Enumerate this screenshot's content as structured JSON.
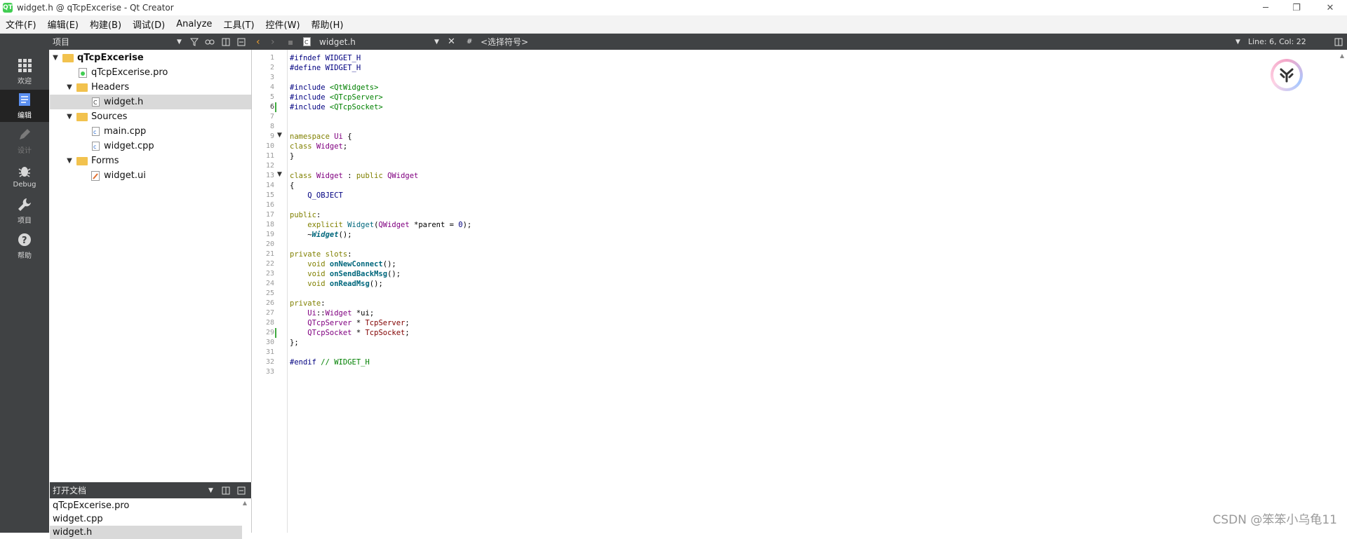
{
  "window": {
    "title": "widget.h @ qTcpExcerise - Qt Creator",
    "app_icon": "QT"
  },
  "menu": [
    "文件(F)",
    "编辑(E)",
    "构建(B)",
    "调试(D)",
    "Analyze",
    "工具(T)",
    "控件(W)",
    "帮助(H)"
  ],
  "toolbar": {
    "panel_title": "项目",
    "file_name": "widget.h",
    "symbol": "<选择符号>",
    "position": "Line: 6, Col: 22",
    "hash": "#"
  },
  "modes": [
    {
      "label": "欢迎",
      "icon": "grid-icon"
    },
    {
      "label": "编辑",
      "icon": "edit-doc-icon"
    },
    {
      "label": "设计",
      "icon": "pencil-icon"
    },
    {
      "label": "Debug",
      "icon": "bug-icon"
    },
    {
      "label": "项目",
      "icon": "wrench-icon"
    },
    {
      "label": "帮助",
      "icon": "help-icon"
    }
  ],
  "tree": {
    "project": "qTcpExcerise",
    "pro_file": "qTcpExcerise.pro",
    "headers": "Headers",
    "header_file": "widget.h",
    "sources": "Sources",
    "source_files": [
      "main.cpp",
      "widget.cpp"
    ],
    "forms": "Forms",
    "form_file": "widget.ui"
  },
  "open_docs": {
    "title": "打开文档",
    "items": [
      "qTcpExcerise.pro",
      "widget.cpp",
      "widget.h"
    ]
  },
  "line_numbers": [
    "1",
    "2",
    "3",
    "4",
    "5",
    "6",
    "7",
    "8",
    "9",
    "10",
    "11",
    "12",
    "13",
    "14",
    "15",
    "16",
    "17",
    "18",
    "19",
    "20",
    "21",
    "22",
    "23",
    "24",
    "25",
    "26",
    "27",
    "28",
    "29",
    "30",
    "31",
    "32",
    "33"
  ],
  "code": {
    "l1a": "#ifndef",
    "l1b": " WIDGET_H",
    "l2a": "#define",
    "l2b": " WIDGET_H",
    "l4a": "#include",
    "l4b": " <QtWidgets>",
    "l5a": "#include",
    "l5b": " <QTcpServer>",
    "l6a": "#include",
    "l6b": " <QTcpSocket>",
    "l9a": "namespace",
    "l9b": " Ui",
    "l9c": " {",
    "l10a": "class",
    "l10b": " Widget",
    "l10c": ";",
    "l11": "}",
    "l13a": "class",
    "l13b": " Widget",
    "l13c": " : ",
    "l13d": "public",
    "l13e": " QWidget",
    "l14": "{",
    "l15": "    Q_OBJECT",
    "l17a": "public",
    "l17b": ":",
    "l18a": "    explicit",
    "l18b": " Widget",
    "l18c": "(",
    "l18d": "QWidget",
    "l18e": " *parent = ",
    "l18f": "0",
    "l18g": ");",
    "l19a": "    ~",
    "l19b": "Widget",
    "l19c": "();",
    "l21a": "private slots",
    "l21b": ":",
    "l22a": "    void",
    "l22b": " onNewConnect",
    "l22c": "();",
    "l23a": "    void",
    "l23b": " onSendBackMsg",
    "l23c": "();",
    "l24a": "    void",
    "l24b": " onReadMsg",
    "l24c": "();",
    "l26a": "private",
    "l26b": ":",
    "l27a": "    Ui",
    "l27b": "::",
    "l27c": "Widget",
    "l27d": " *ui;",
    "l28a": "    QTcpServer",
    "l28b": " * ",
    "l28c": "TcpServer",
    "l28d": ";",
    "l29a": "    QTcpSocket",
    "l29b": " * ",
    "l29c": "TcpSocket",
    "l29d": ";",
    "l30": "};",
    "l32a": "#endif",
    "l32b": " // WIDGET_H"
  },
  "watermark": "CSDN @笨笨小乌龟11"
}
